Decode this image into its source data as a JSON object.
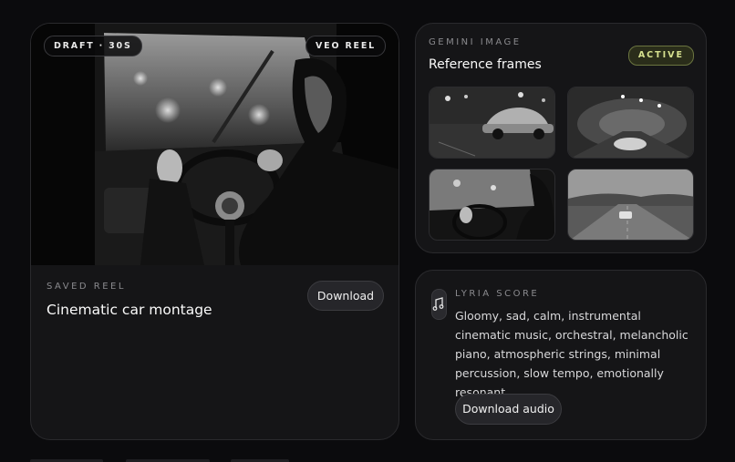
{
  "reel": {
    "draft_badge": "DRAFT · 30S",
    "source_badge": "VEO REEL",
    "eyebrow": "SAVED REEL",
    "title": "Cinematic car montage",
    "download_label": "Download",
    "image_icon": "driver-at-wheel-photo"
  },
  "gemini": {
    "eyebrow": "GEMINI IMAGE",
    "title": "Reference frames",
    "status": "ACTIVE",
    "status_color": "#d6e08e",
    "frames": [
      {
        "icon": "vintage-car-rainy-street-photo"
      },
      {
        "icon": "car-in-tunnel-photo"
      },
      {
        "icon": "driver-hands-on-wheel-photo"
      },
      {
        "icon": "car-on-open-road-photo"
      }
    ]
  },
  "lyria": {
    "icon": "music-note-icon",
    "eyebrow": "LYRIA SCORE",
    "prompt": "Gloomy, sad, calm, instrumental cinematic music, orchestral, melancholic piano, atmospheric strings, minimal percussion, slow tempo, emotionally resonant.",
    "download_audio_label": "Download audio"
  }
}
